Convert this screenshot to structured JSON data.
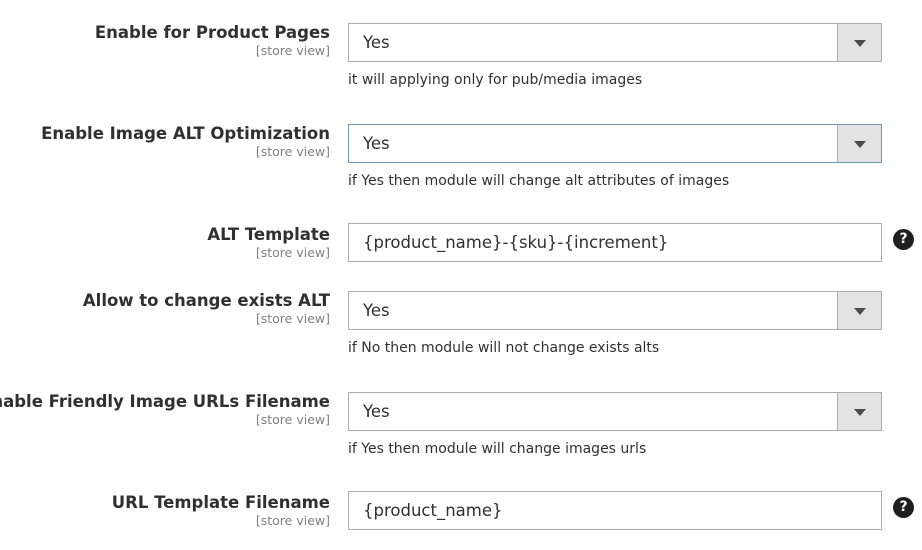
{
  "scope_label": "[store view]",
  "fields": [
    {
      "label": "Enable for Product Pages",
      "value": "Yes",
      "note": "it will applying only for pub/media images"
    },
    {
      "label": "Enable Image ALT Optimization",
      "value": "Yes",
      "note": "if Yes then module will change alt attributes of images"
    },
    {
      "label": "ALT Template",
      "value": "{product_name}-{sku}-{increment}",
      "help": "?"
    },
    {
      "label": "Allow to change exists ALT",
      "value": "Yes",
      "note": "if No then module will not change exists alts"
    },
    {
      "label": "Enable Friendly Image URLs Filename",
      "value": "Yes",
      "note": "if Yes then module will change images urls"
    },
    {
      "label": "URL Template Filename",
      "value": "{product_name}",
      "help": "?"
    }
  ],
  "icons": {
    "select_arrow": "chevron-down-icon",
    "help": "question-circle-icon"
  }
}
